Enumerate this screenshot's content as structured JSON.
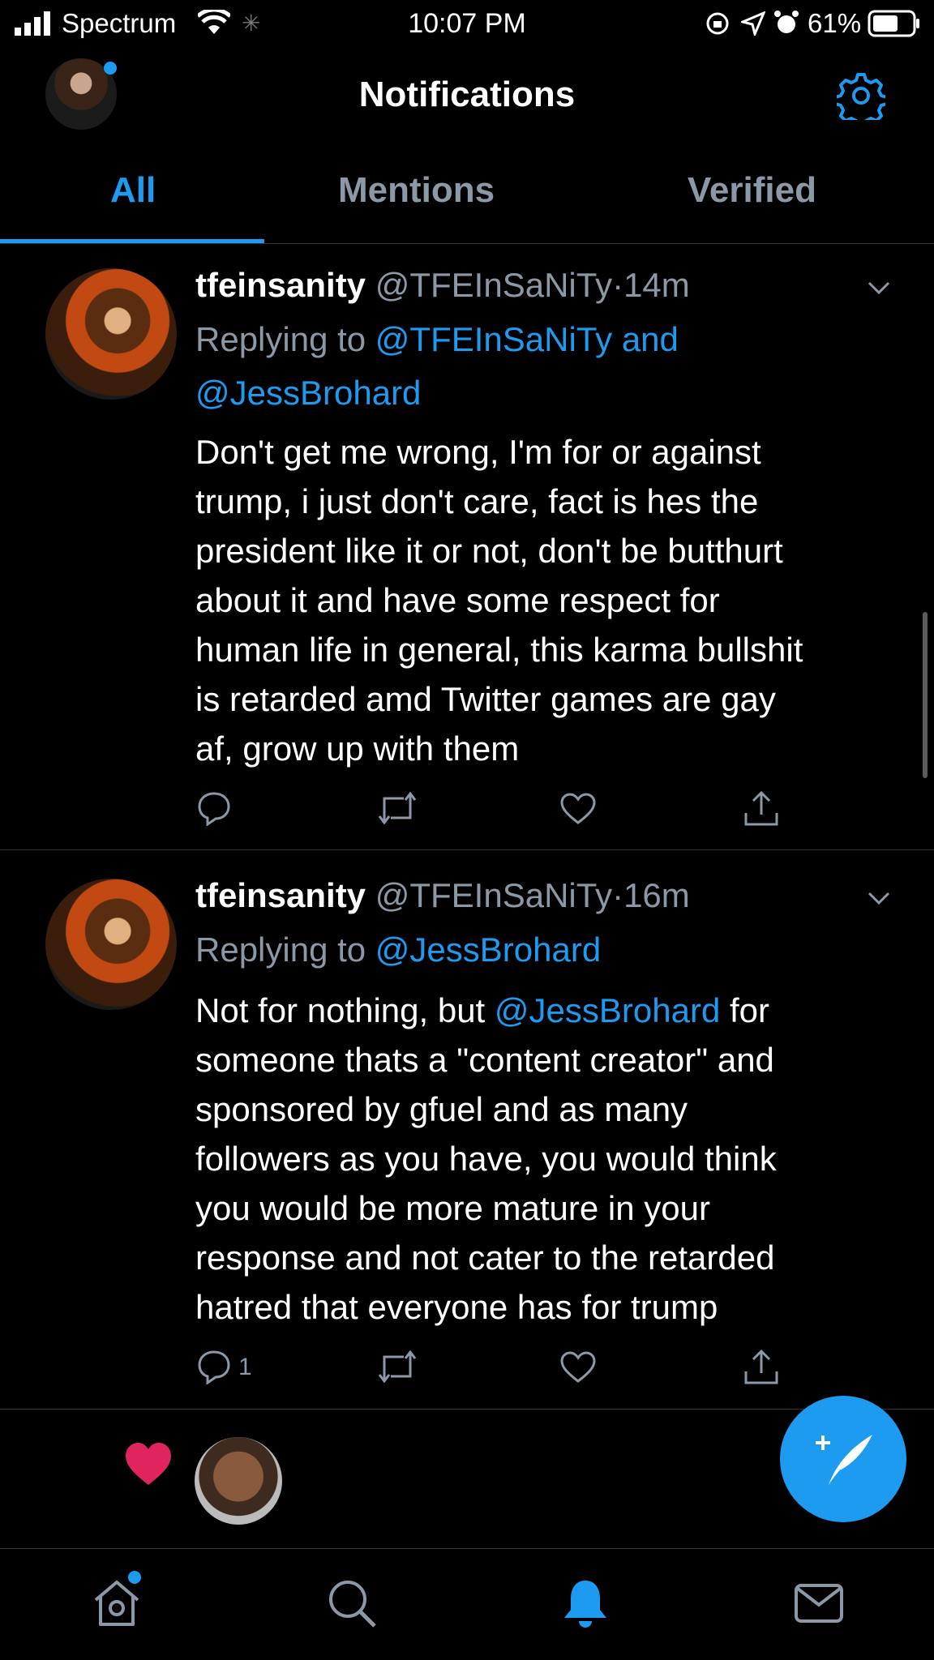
{
  "status_bar": {
    "carrier": "Spectrum",
    "time": "10:07 PM",
    "battery": "61%"
  },
  "header": {
    "title": "Notifications"
  },
  "tabs": [
    {
      "label": "All",
      "active": true
    },
    {
      "label": "Mentions",
      "active": false
    },
    {
      "label": "Verified",
      "active": false
    }
  ],
  "tweets": [
    {
      "name": "tfeinsanity",
      "handle": "@TFEInSaNiTy",
      "separator": "·",
      "time": "14m",
      "replying_prefix": "Replying to",
      "replying_to_line1": "@TFEInSaNiTy and",
      "replying_to_line2": "@JessBrohard",
      "body_lines": [
        "Don't get me wrong, I'm for or against",
        "trump, i just don't care, fact is hes the",
        "president like it or not, don't be butthurt",
        "about it and have some respect for",
        "human life in general, this karma bullshit",
        "is retarded amd Twitter games are gay",
        "af, grow up with them"
      ],
      "reply_count": ""
    },
    {
      "name": "tfeinsanity",
      "handle": "@TFEInSaNiTy",
      "separator": "·",
      "time": "16m",
      "replying_prefix": "Replying to",
      "replying_to_line1": "@JessBrohard",
      "body_first_prefix": "Not for nothing, but ",
      "body_first_mention": "@JessBrohard",
      "body_first_suffix": " for",
      "body_lines": [
        "someone thats a \"content creator\" and",
        "sponsored by gfuel and as many",
        "followers as you have, you would think",
        "you would be more mature in your",
        "response and not cater to the retarded",
        "hatred that everyone has for trump"
      ],
      "reply_count": "1"
    }
  ],
  "colors": {
    "accent": "#1d9bf0",
    "muted": "#8b98a5",
    "like_red": "#e0245e"
  },
  "icons": {
    "settings": "gear-icon",
    "compose": "compose-tweet-icon",
    "nav": [
      "home-icon",
      "search-icon",
      "bell-icon",
      "mail-icon"
    ]
  }
}
